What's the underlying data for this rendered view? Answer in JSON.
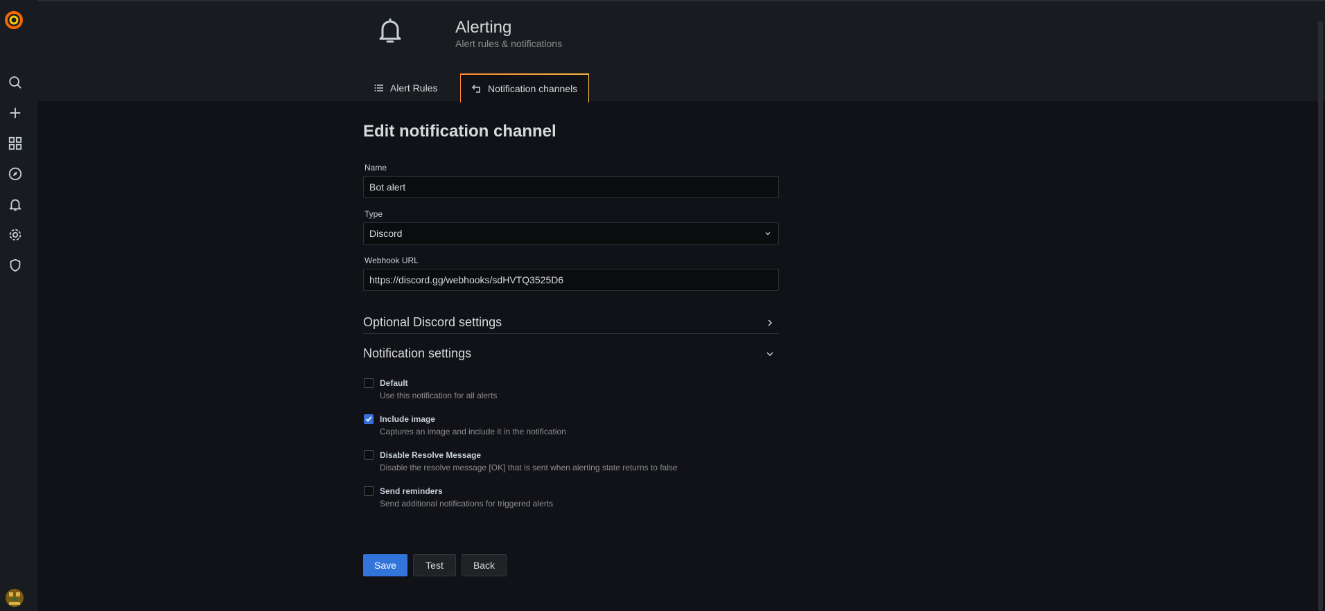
{
  "header": {
    "title": "Alerting",
    "subtitle": "Alert rules & notifications",
    "icon": "bell-icon"
  },
  "tabs": [
    {
      "label": "Alert Rules",
      "icon": "list-icon",
      "active": false
    },
    {
      "label": "Notification channels",
      "icon": "channel-icon",
      "active": true
    }
  ],
  "sidebar": {
    "items": [
      "search-icon",
      "plus-icon",
      "dashboards-icon",
      "explore-icon",
      "alerting-icon",
      "configuration-icon",
      "server-admin-icon"
    ]
  },
  "form": {
    "title": "Edit notification channel",
    "name_label": "Name",
    "name_value": "Bot alert",
    "type_label": "Type",
    "type_value": "Discord",
    "webhook_label": "Webhook URL",
    "webhook_value": "https://discord.gg/webhooks/sdHVTQ3525D6"
  },
  "sections": {
    "optional": "Optional Discord settings",
    "notification": "Notification settings"
  },
  "checkboxes": [
    {
      "label": "Default",
      "desc": "Use this notification for all alerts",
      "checked": false
    },
    {
      "label": "Include image",
      "desc": "Captures an image and include it in the notification",
      "checked": true
    },
    {
      "label": "Disable Resolve Message",
      "desc": "Disable the resolve message [OK] that is sent when alerting state returns to false",
      "checked": false
    },
    {
      "label": "Send reminders",
      "desc": "Send additional notifications for triggered alerts",
      "checked": false
    }
  ],
  "buttons": {
    "save": "Save",
    "test": "Test",
    "back": "Back"
  },
  "colors": {
    "accent": "#3274d9",
    "tab_gradient_start": "#ff8833",
    "tab_gradient_end": "#f5b73d"
  }
}
